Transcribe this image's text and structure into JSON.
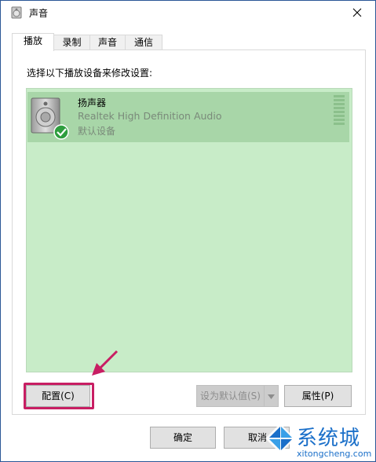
{
  "window": {
    "title": "声音"
  },
  "tabs": [
    {
      "label": "播放",
      "active": true
    },
    {
      "label": "录制",
      "active": false
    },
    {
      "label": "声音",
      "active": false
    },
    {
      "label": "通信",
      "active": false
    }
  ],
  "instruction": "选择以下播放设备来修改设置:",
  "devices": [
    {
      "name": "扬声器",
      "driver": "Realtek High Definition Audio",
      "status": "默认设备",
      "icon": "speaker-icon",
      "badge": "check-icon"
    }
  ],
  "buttons": {
    "configure": "配置(C)",
    "set_default": "设为默认值(S)",
    "properties": "属性(P)",
    "ok": "确定",
    "cancel": "取消"
  },
  "watermark": {
    "text": "系统城",
    "url": "xitongcheng.com"
  },
  "colors": {
    "list_bg": "#c8ecc8",
    "selected_bg": "#a8d6a8",
    "highlight": "#c81e63",
    "watermark": "#1a6fc9"
  }
}
